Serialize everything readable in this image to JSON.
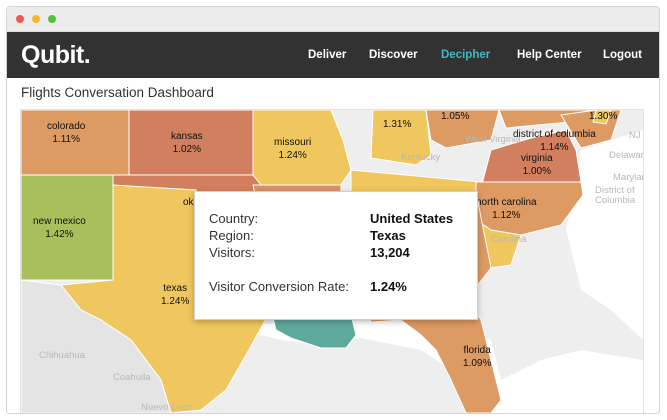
{
  "app": {
    "brand": "Qubit."
  },
  "nav": {
    "items": [
      "Deliver",
      "Discover",
      "Decipher",
      "Help Center",
      "Logout"
    ],
    "active": "Decipher"
  },
  "page": {
    "title": "Flights Conversation Dashboard"
  },
  "colors": {
    "navbar": "#323232",
    "active_nav": "#3fb9c7",
    "high": "#a8bf5b",
    "mid": "#efc75e",
    "low": "#d27c5b",
    "teal": "#5fa89c"
  },
  "map": {
    "states": [
      {
        "name": "colorado",
        "rate": "1.11%"
      },
      {
        "name": "kansas",
        "rate": "1.02%"
      },
      {
        "name": "missouri",
        "rate": "1.24%"
      },
      {
        "name": "new mexico",
        "rate": "1.42%"
      },
      {
        "name": "texas",
        "rate": "1.24%"
      },
      {
        "name": "ok",
        "rate": ""
      },
      {
        "name": "",
        "rate": "1.31%"
      },
      {
        "name": "",
        "rate": "1.05%"
      },
      {
        "name": "",
        "rate": "1.30%"
      },
      {
        "name": "district of columbia",
        "rate": "1.14%"
      },
      {
        "name": "virginia",
        "rate": "1.00%"
      },
      {
        "name": "north carolina",
        "rate": "1.12%"
      },
      {
        "name": "florida",
        "rate": "1.09%"
      }
    ],
    "geo_labels": [
      "Kentucky",
      "West Virginia",
      "Carolina",
      "Chihuahua",
      "Coahuila",
      "Nuevo Leon",
      "Delaware",
      "Maryland",
      "District of Columbia",
      "NJ"
    ]
  },
  "tooltip": {
    "country_label": "Country:",
    "country": "United States",
    "region_label": "Region:",
    "region": "Texas",
    "visitors_label": "Visitors:",
    "visitors": "13,204",
    "rate_label": "Visitor Conversion Rate:",
    "rate": "1.24%"
  }
}
